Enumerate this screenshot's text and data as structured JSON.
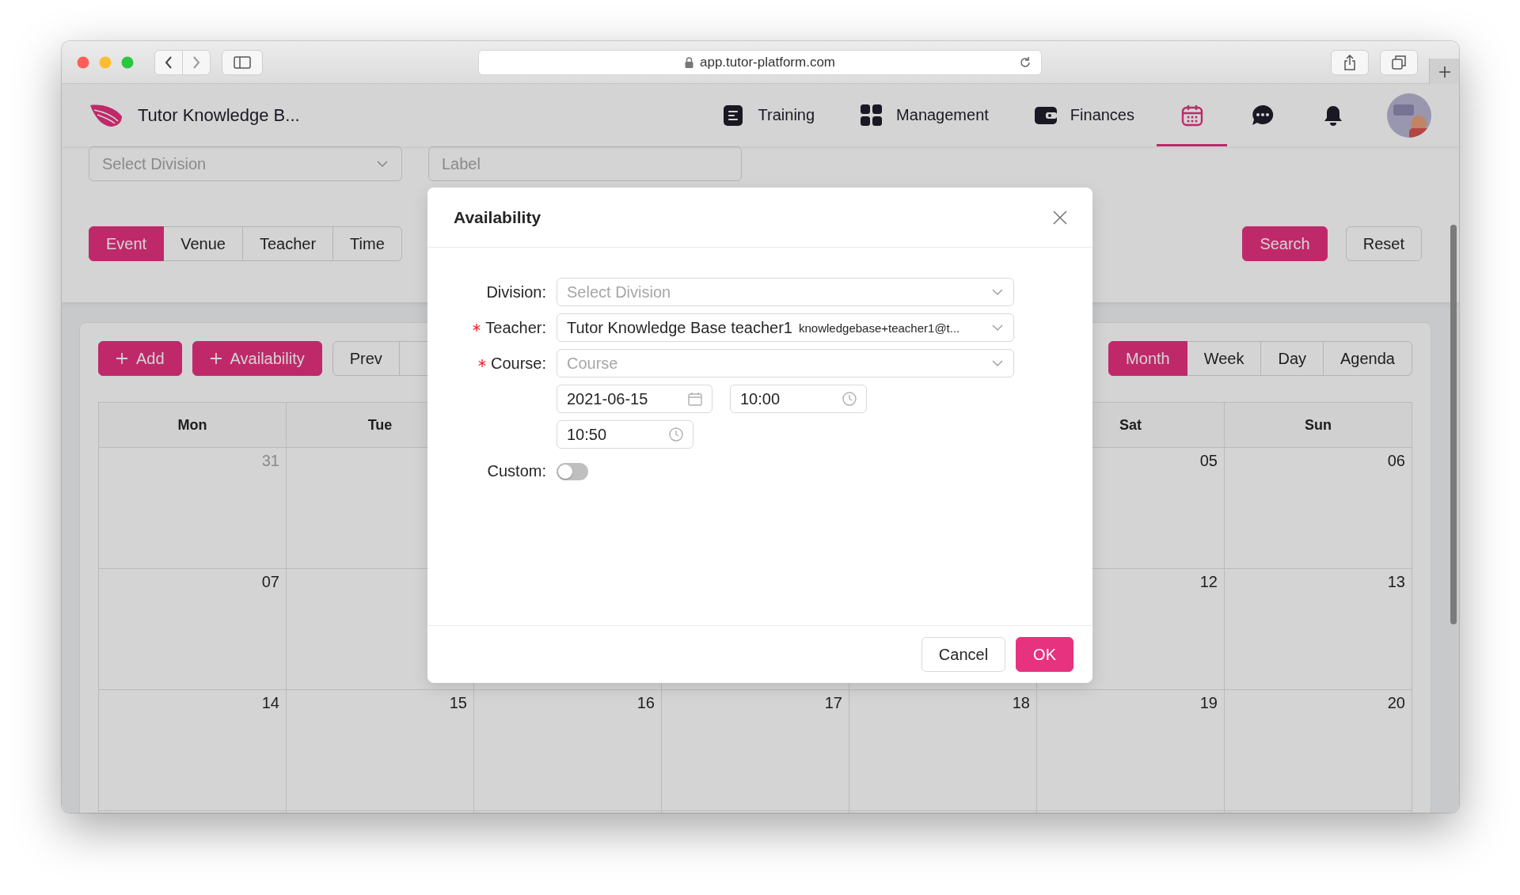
{
  "browser": {
    "url": "app.tutor-platform.com"
  },
  "header": {
    "title": "Tutor Knowledge B...",
    "nav": [
      {
        "kind": "training",
        "label": "Training",
        "selected": false
      },
      {
        "kind": "management",
        "label": "Management",
        "selected": false
      },
      {
        "kind": "finances",
        "label": "Finances",
        "selected": false
      },
      {
        "kind": "calendar",
        "selected": true
      },
      {
        "kind": "chat",
        "selected": false
      },
      {
        "kind": "bell",
        "selected": false
      }
    ]
  },
  "filters": {
    "division": {
      "placeholder": "Select Division"
    },
    "label": {
      "placeholder": "Label"
    },
    "tabs": [
      {
        "label": "Event",
        "selected": true
      },
      {
        "label": "Venue",
        "selected": false
      },
      {
        "label": "Teacher",
        "selected": false
      },
      {
        "label": "Time",
        "selected": false
      }
    ],
    "buttons": [
      {
        "label": "Search",
        "kind": "primary"
      },
      {
        "label": "Reset",
        "kind": "default"
      }
    ]
  },
  "calendar": {
    "actions": [
      {
        "label": "Add"
      },
      {
        "label": "Availability"
      }
    ],
    "prev": "Prev",
    "views": [
      {
        "label": "Month",
        "selected": true
      },
      {
        "label": "Week",
        "selected": false
      },
      {
        "label": "Day",
        "selected": false
      },
      {
        "label": "Agenda",
        "selected": false
      }
    ],
    "weekdays": [
      {
        "kind": "mon",
        "label": "Mon"
      },
      {
        "kind": "tue",
        "label": "Tue"
      },
      {
        "kind": "sat",
        "label": "Sat"
      },
      {
        "kind": "sun",
        "label": "Sun"
      }
    ],
    "weeks": [
      [
        {
          "kind": "mon",
          "date": "31",
          "muted": true
        },
        {
          "kind": "sat",
          "date": "05",
          "muted": false
        },
        {
          "kind": "sun",
          "date": "06",
          "muted": false
        }
      ],
      [
        {
          "kind": "mon",
          "date": "07",
          "muted": false
        },
        {
          "kind": "sat",
          "date": "12",
          "muted": false
        },
        {
          "kind": "sun",
          "date": "13",
          "muted": false
        }
      ],
      [
        {
          "kind": "mon",
          "date": "14",
          "muted": false
        },
        {
          "kind": "tue",
          "date": "15",
          "muted": false
        },
        {
          "kind": "wed",
          "date": "16",
          "muted": false
        },
        {
          "kind": "thu",
          "date": "17",
          "muted": false
        },
        {
          "kind": "fri",
          "date": "18",
          "muted": false
        },
        {
          "kind": "sat",
          "date": "19",
          "muted": false
        },
        {
          "kind": "sun",
          "date": "20",
          "muted": false
        }
      ]
    ]
  },
  "modal": {
    "title": "Availability",
    "fields": [
      {
        "kind": "select",
        "label": "Division:",
        "required": false,
        "placeholder": "Select Division"
      },
      {
        "kind": "select",
        "label": "Teacher:",
        "required": true,
        "value": "Tutor Knowledge Base teacher1",
        "detail": "knowledgebase+teacher1@t..."
      },
      {
        "kind": "select",
        "label": "Course:",
        "required": true,
        "placeholder": "Course"
      },
      {
        "kind": "datetime",
        "date": "2021-06-15",
        "start_time": "10:00",
        "end_time": "10:50"
      },
      {
        "kind": "switch",
        "label": "Custom:",
        "on": false
      }
    ],
    "buttons": [
      {
        "label": "Cancel",
        "kind": "default"
      },
      {
        "label": "OK",
        "kind": "primary"
      }
    ]
  }
}
